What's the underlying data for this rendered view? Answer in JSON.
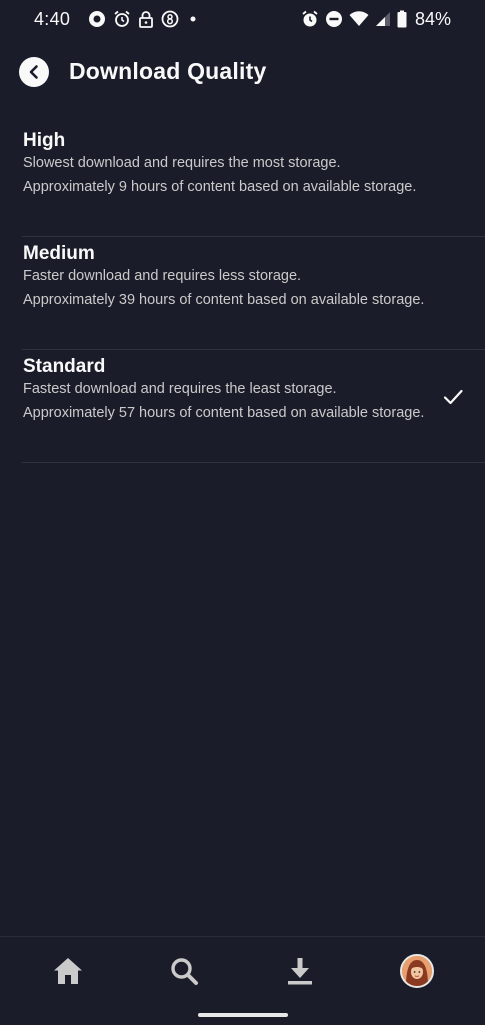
{
  "status_bar": {
    "time": "4:40",
    "battery_percent": "84%",
    "left_icons": [
      "record-icon",
      "alarm-clock-icon",
      "lock-icon",
      "number-badge-icon",
      "dot-icon"
    ],
    "right_icons": [
      "alarm-clock-icon",
      "do-not-disturb-icon",
      "wifi-icon",
      "cellular-signal-icon",
      "battery-icon"
    ]
  },
  "header": {
    "title": "Download Quality",
    "back_icon": "chevron-left-icon"
  },
  "options": [
    {
      "title": "High",
      "line1": "Slowest download and requires the most storage.",
      "line2": "Approximately 9 hours of content based on available storage.",
      "selected": false
    },
    {
      "title": "Medium",
      "line1": "Faster download and requires less storage.",
      "line2": "Approximately 39 hours of content based on available storage.",
      "selected": false
    },
    {
      "title": "Standard",
      "line1": "Fastest download and requires the least storage.",
      "line2": "Approximately 57 hours of content based on available storage.",
      "selected": true
    }
  ],
  "bottom_nav": {
    "items": [
      "home-icon",
      "search-icon",
      "download-icon",
      "profile-avatar"
    ]
  },
  "colors": {
    "background": "#1a1d29",
    "text": "#f9f9f9",
    "secondary_text": "#cacaca",
    "divider": "#30333e"
  }
}
